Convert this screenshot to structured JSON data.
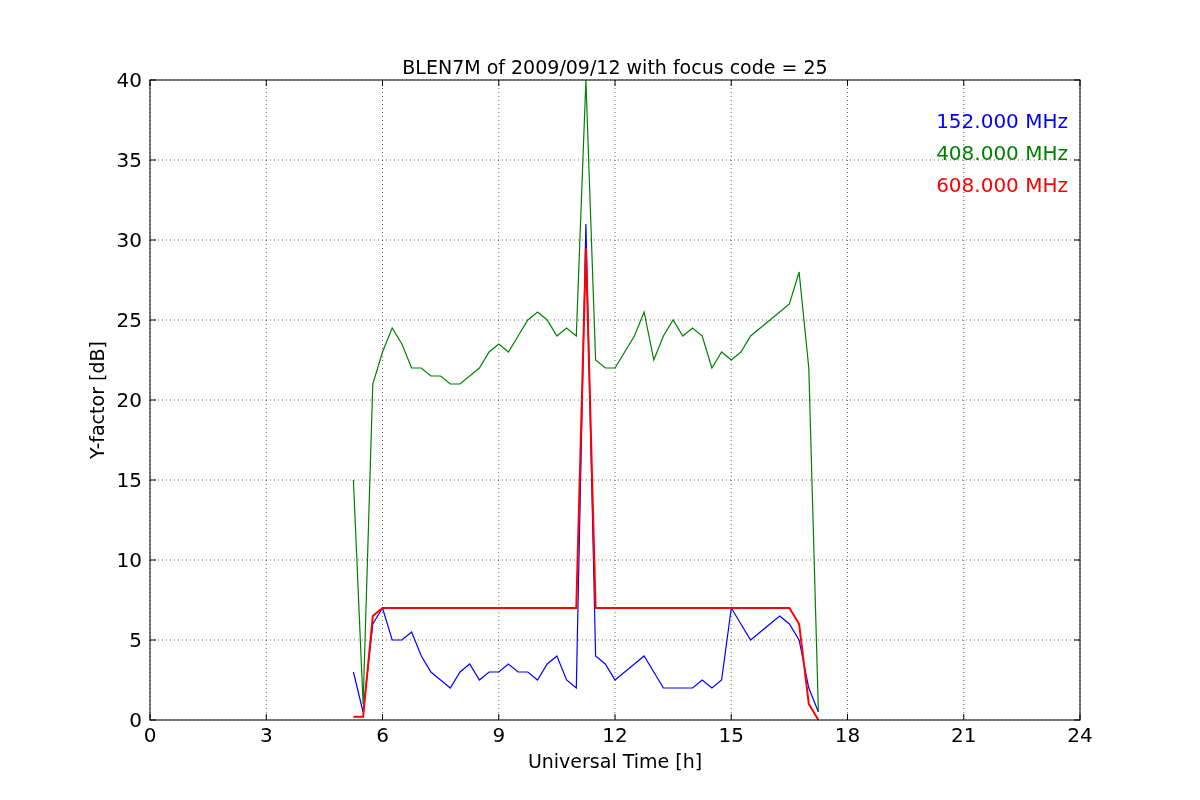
{
  "chart_data": {
    "type": "line",
    "title": "BLEN7M of 2009/09/12 with focus code = 25",
    "xlabel": "Universal Time [h]",
    "ylabel": "Y-factor [dB]",
    "x": [
      5.25,
      5.5,
      5.75,
      6.0,
      6.25,
      6.5,
      6.75,
      7.0,
      7.25,
      7.5,
      7.75,
      8.0,
      8.25,
      8.5,
      8.75,
      9.0,
      9.25,
      9.5,
      9.75,
      10.0,
      10.25,
      10.5,
      10.75,
      11.0,
      11.25,
      11.5,
      11.75,
      12.0,
      12.25,
      12.5,
      12.75,
      13.0,
      13.25,
      13.5,
      13.75,
      14.0,
      14.25,
      14.5,
      14.75,
      15.0,
      15.25,
      15.5,
      15.75,
      16.0,
      16.25,
      16.5,
      16.75,
      17.0,
      17.25
    ],
    "series": [
      {
        "name": "152.000 MHz",
        "color": "#0000ff",
        "values": [
          3,
          0.5,
          6,
          7,
          5,
          5,
          5.5,
          4,
          3,
          2.5,
          2,
          3,
          3.5,
          2.5,
          3,
          3,
          3.5,
          3,
          3,
          2.5,
          3.5,
          4,
          2.5,
          2,
          31,
          4,
          3.5,
          2.5,
          3,
          3.5,
          4,
          3,
          2,
          2,
          2,
          2,
          2.5,
          2,
          2.5,
          7,
          6,
          5,
          5.5,
          6,
          6.5,
          6,
          5,
          2,
          0.5
        ]
      },
      {
        "name": "408.000 MHz",
        "color": "#008000",
        "values": [
          15,
          1,
          21,
          23,
          24.5,
          23.5,
          22,
          22,
          21.5,
          21.5,
          21,
          21,
          21.5,
          22,
          23,
          23.5,
          23,
          24,
          25,
          25.5,
          25,
          24,
          24.5,
          24,
          40,
          22.5,
          22,
          22,
          23,
          24,
          25.5,
          22.5,
          24,
          25,
          24,
          24.5,
          24,
          22,
          23,
          22.5,
          23,
          24,
          24.5,
          25,
          25.5,
          26,
          28,
          22,
          0.5
        ]
      },
      {
        "name": "608.000 MHz",
        "color": "#ff0000",
        "values": [
          0.2,
          0.2,
          6.5,
          7,
          7,
          7,
          7,
          7,
          7,
          7,
          7,
          7,
          7,
          7,
          7,
          7,
          7,
          7,
          7,
          7,
          7,
          7,
          7,
          7,
          29.5,
          7,
          7,
          7,
          7,
          7,
          7,
          7,
          7,
          7,
          7,
          7,
          7,
          7,
          7,
          7,
          7,
          7,
          7,
          7,
          7,
          7,
          6,
          1,
          0
        ]
      }
    ],
    "xlim": [
      0,
      24
    ],
    "ylim": [
      0,
      40
    ],
    "xticks": [
      0,
      3,
      6,
      9,
      12,
      15,
      18,
      21,
      24
    ],
    "yticks": [
      0,
      5,
      10,
      15,
      20,
      25,
      30,
      35,
      40
    ],
    "grid": true
  }
}
